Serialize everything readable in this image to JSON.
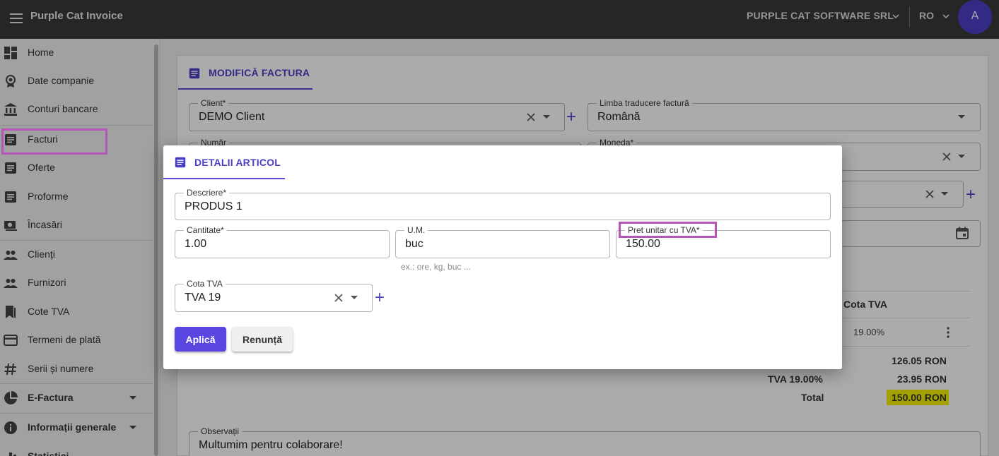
{
  "app": {
    "title": "Purple Cat Invoice",
    "company": "PURPLE CAT SOFTWARE SRL",
    "language": "RO",
    "avatar_letter": "A"
  },
  "sidebar": {
    "items": [
      {
        "label": "Home",
        "icon": "dashboard-icon"
      },
      {
        "label": "Date companie",
        "icon": "badge-icon"
      },
      {
        "label": "Conturi bancare",
        "icon": "bank-icon"
      },
      {
        "label": "Facturi",
        "icon": "document-icon"
      },
      {
        "label": "Oferte",
        "icon": "document-icon"
      },
      {
        "label": "Proforme",
        "icon": "document-icon"
      },
      {
        "label": "Încasări",
        "icon": "cash-icon"
      },
      {
        "label": "Clienți",
        "icon": "people-icon"
      },
      {
        "label": "Furnizori",
        "icon": "people-icon"
      },
      {
        "label": "Cote TVA",
        "icon": "bookmark-icon"
      },
      {
        "label": "Termeni de plată",
        "icon": "card-icon"
      },
      {
        "label": "Serii și numere",
        "icon": "hash-icon"
      },
      {
        "label": "E-Factura",
        "icon": "pie-icon"
      },
      {
        "label": "Informații generale",
        "icon": "info-icon"
      },
      {
        "label": "Statistici",
        "icon": "chart-icon"
      }
    ]
  },
  "invoice": {
    "tab_label": "MODIFICĂ FACTURA",
    "client_label": "Client*",
    "client_value": "DEMO Client",
    "lang_label": "Limba traducere factură",
    "lang_value": "Română",
    "numar_label": "Număr",
    "moneda_label": "Moneda*",
    "table_col_tva": "Cota TVA",
    "row_tva": "19.00%",
    "subtotal": "126.05 RON",
    "tva_label": "TVA 19.00%",
    "tva_value": "23.95 RON",
    "total_label": "Total",
    "total_value": "150.00 RON",
    "obs_label": "Observații",
    "obs_value": "Multumim pentru colaborare!"
  },
  "modal": {
    "tab_label": "DETALII ARTICOL",
    "descriere_label": "Descriere*",
    "descriere_value": "PRODUS 1",
    "cantitate_label": "Cantitate*",
    "cantitate_value": "1.00",
    "um_label": "U.M.",
    "um_value": "buc",
    "um_helper": "ex.: ore, kg, buc ...",
    "pret_label": "Pret unitar cu TVA*",
    "pret_value": "150.00",
    "cota_label": "Cota TVA",
    "cota_value": "TVA 19",
    "apply_label": "Aplică",
    "cancel_label": "Renunță"
  },
  "colors": {
    "accent": "#5a46e0",
    "highlight_box": "#b455b8",
    "marker": "#f3f000",
    "topbar": "#3a3a3a"
  }
}
